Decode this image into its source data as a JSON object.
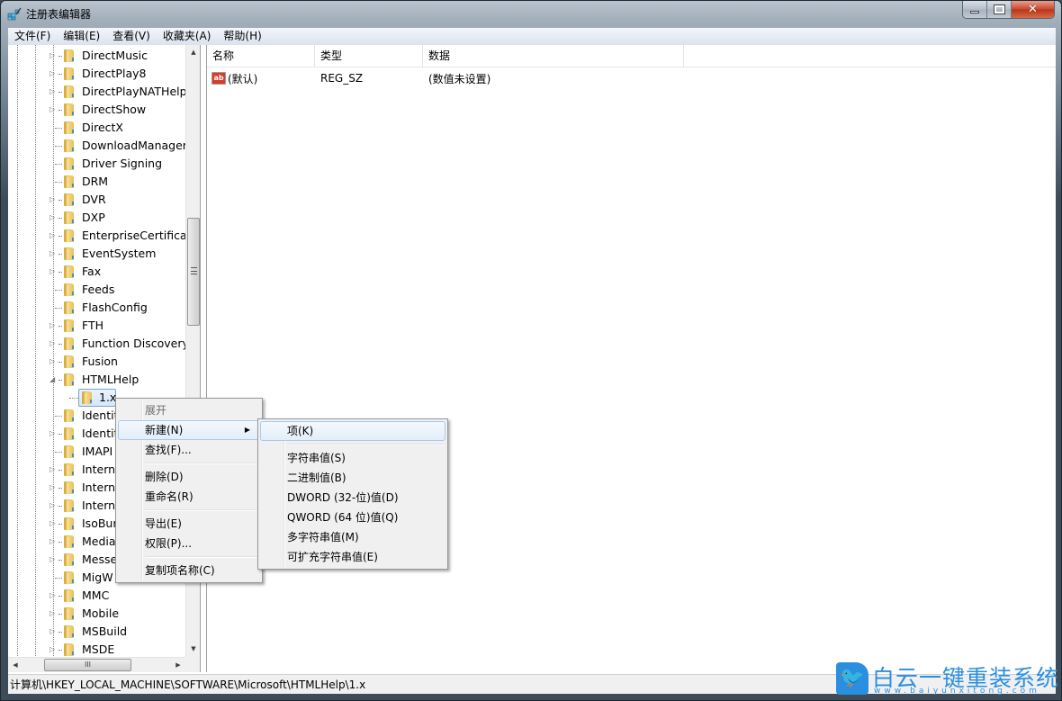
{
  "window": {
    "title": "注册表编辑器",
    "controls": {
      "minimize": "minimize",
      "maximize": "maximize",
      "close": "✕"
    }
  },
  "menubar": {
    "items": [
      {
        "label": "文件(F)"
      },
      {
        "label": "编辑(E)"
      },
      {
        "label": "查看(V)"
      },
      {
        "label": "收藏夹(A)"
      },
      {
        "label": "帮助(H)"
      }
    ]
  },
  "tree": {
    "items": [
      {
        "label": "DirectMusic",
        "expandable": true
      },
      {
        "label": "DirectPlay8",
        "expandable": true
      },
      {
        "label": "DirectPlayNATHelp",
        "expandable": true
      },
      {
        "label": "DirectShow",
        "expandable": true
      },
      {
        "label": "DirectX",
        "expandable": false
      },
      {
        "label": "DownloadManager",
        "expandable": false
      },
      {
        "label": "Driver Signing",
        "expandable": false
      },
      {
        "label": "DRM",
        "expandable": false
      },
      {
        "label": "DVR",
        "expandable": true
      },
      {
        "label": "DXP",
        "expandable": true
      },
      {
        "label": "EnterpriseCertificate",
        "expandable": true
      },
      {
        "label": "EventSystem",
        "expandable": true
      },
      {
        "label": "Fax",
        "expandable": true
      },
      {
        "label": "Feeds",
        "expandable": false
      },
      {
        "label": "FlashConfig",
        "expandable": false
      },
      {
        "label": "FTH",
        "expandable": true
      },
      {
        "label": "Function Discovery",
        "expandable": true
      },
      {
        "label": "Fusion",
        "expandable": true
      },
      {
        "label": "HTMLHelp",
        "expandable": true,
        "expanded": true
      },
      {
        "label": "1.x",
        "child": true,
        "selected": true
      },
      {
        "label": "Identit",
        "expandable": false
      },
      {
        "label": "Identit",
        "expandable": true
      },
      {
        "label": "IMAPI",
        "expandable": false
      },
      {
        "label": "Intern",
        "expandable": true
      },
      {
        "label": "Intern",
        "expandable": true
      },
      {
        "label": "Intern",
        "expandable": true
      },
      {
        "label": "IsoBur",
        "expandable": true
      },
      {
        "label": "Media",
        "expandable": true
      },
      {
        "label": "Messe",
        "expandable": true
      },
      {
        "label": "MigW",
        "expandable": false
      },
      {
        "label": "MMC",
        "expandable": true
      },
      {
        "label": "Mobile",
        "expandable": true
      },
      {
        "label": "MSBuild",
        "expandable": true
      },
      {
        "label": "MSDE",
        "expandable": true
      }
    ],
    "hscroll_thumb_glyph": "III"
  },
  "list": {
    "columns": [
      "名称",
      "类型",
      "数据"
    ],
    "rows": [
      {
        "icon": "ab",
        "name": "(默认)",
        "type": "REG_SZ",
        "data": "(数值未设置)"
      }
    ]
  },
  "context_menu": {
    "items": [
      {
        "label": "展开",
        "kind": "bold"
      },
      {
        "label": "新建(N)",
        "kind": "submenu",
        "hover": true
      },
      {
        "label": "查找(F)..."
      },
      {
        "kind": "separator"
      },
      {
        "label": "删除(D)"
      },
      {
        "label": "重命名(R)"
      },
      {
        "kind": "separator"
      },
      {
        "label": "导出(E)"
      },
      {
        "label": "权限(P)..."
      },
      {
        "kind": "separator"
      },
      {
        "label": "复制项名称(C)"
      }
    ]
  },
  "submenu": {
    "items": [
      {
        "label": "项(K)",
        "hover": true
      },
      {
        "kind": "separator"
      },
      {
        "label": "字符串值(S)"
      },
      {
        "label": "二进制值(B)"
      },
      {
        "label": "DWORD (32-位)值(D)"
      },
      {
        "label": "QWORD (64 位)值(Q)"
      },
      {
        "label": "多字符串值(M)"
      },
      {
        "label": "可扩充字符串值(E)"
      }
    ]
  },
  "statusbar": {
    "path": "计算机\\HKEY_LOCAL_MACHINE\\SOFTWARE\\Microsoft\\HTMLHelp\\1.x"
  },
  "watermark": {
    "title": "白云一键重装系统",
    "url": "www.baiyunxitong.com",
    "brand_color": "#2b8fe0"
  }
}
